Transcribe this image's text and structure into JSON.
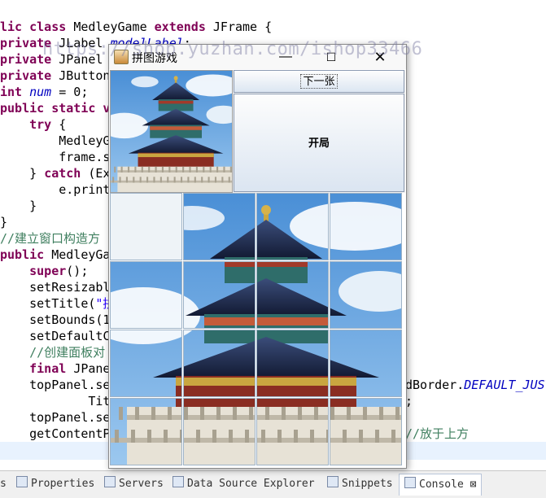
{
  "code_lines": [
    {
      "segments": [
        {
          "t": "lic class MedleyGame ",
          "c": "kw2"
        },
        {
          "t": "extends ",
          "c": "kw"
        },
        {
          "t": "JFrame {",
          "c": ""
        }
      ]
    },
    {
      "segments": [
        {
          "t": "private ",
          "c": "kw"
        },
        {
          "t": "JLabel ",
          "c": ""
        },
        {
          "t": "modelLabel",
          "c": "fld"
        },
        {
          "t": ";",
          "c": ""
        }
      ]
    },
    {
      "segments": [
        {
          "t": "private ",
          "c": "kw"
        },
        {
          "t": "JPanel",
          "c": ""
        }
      ]
    },
    {
      "segments": [
        {
          "t": "private ",
          "c": "kw"
        },
        {
          "t": "JButton",
          "c": ""
        }
      ]
    },
    {
      "segments": [
        {
          "t": "int ",
          "c": "kw"
        },
        {
          "t": "num",
          "c": "fld"
        },
        {
          "t": " = 0;",
          "c": ""
        }
      ]
    },
    {
      "segments": [
        {
          "t": "public static v",
          "c": "kw"
        }
      ]
    },
    {
      "segments": [
        {
          "t": "    try ",
          "c": "kw"
        },
        {
          "t": "{",
          "c": ""
        }
      ]
    },
    {
      "segments": [
        {
          "t": "        MedleyG",
          "c": ""
        }
      ]
    },
    {
      "segments": [
        {
          "t": "        frame.s",
          "c": ""
        }
      ]
    },
    {
      "segments": [
        {
          "t": "    } ",
          "c": ""
        },
        {
          "t": "catch ",
          "c": "kw"
        },
        {
          "t": "(Ex",
          "c": ""
        }
      ]
    },
    {
      "segments": [
        {
          "t": "        e.print",
          "c": ""
        }
      ]
    },
    {
      "segments": [
        {
          "t": "    }",
          "c": ""
        }
      ]
    },
    {
      "segments": [
        {
          "t": "}",
          "c": ""
        }
      ]
    },
    {
      "segments": [
        {
          "t": "//建立窗口构造方",
          "c": "cm"
        }
      ]
    },
    {
      "segments": [
        {
          "t": "public ",
          "c": "kw"
        },
        {
          "t": "MedleyGa",
          "c": ""
        }
      ]
    },
    {
      "segments": [
        {
          "t": "    super",
          "c": "kw"
        },
        {
          "t": "();",
          "c": ""
        }
      ]
    },
    {
      "segments": [
        {
          "t": "    setResizabl",
          "c": ""
        }
      ]
    },
    {
      "segments": [
        {
          "t": "    setTitle(",
          "c": ""
        },
        {
          "t": "\"拼",
          "c": "st"
        }
      ]
    },
    {
      "segments": [
        {
          "t": "    setBounds(1",
          "c": ""
        }
      ]
    },
    {
      "segments": [
        {
          "t": "    setDefaultC",
          "c": ""
        }
      ]
    },
    {
      "segments": [
        {
          "t": "    //创建面板对",
          "c": "cm"
        }
      ]
    },
    {
      "segments": [
        {
          "t": "    final ",
          "c": "kw"
        },
        {
          "t": "JPane",
          "c": ""
        }
      ]
    },
    {
      "segments": [
        {
          "t": "    topPanel.se",
          "c": ""
        }
      ]
    },
    {
      "segments": [
        {
          "t": "            Tit",
          "c": ""
        }
      ]
    },
    {
      "segments": [
        {
          "t": "    topPanel.se",
          "c": ""
        }
      ]
    },
    {
      "segments": [
        {
          "t": "    getContentP",
          "c": ""
        }
      ]
    }
  ],
  "code_right_fragments": [
    {
      "row": 22,
      "segments": [
        {
          "t": "dBorder.",
          "c": ""
        },
        {
          "t": "DEFAULT_JUST",
          "c": "fld"
        }
      ]
    },
    {
      "row": 23,
      "segments": [
        {
          "t": ";",
          "c": ""
        }
      ]
    },
    {
      "row": 25,
      "segments": [
        {
          "t": "//放于上方",
          "c": "cm"
        }
      ]
    }
  ],
  "watermark": "https://shop.yuzhan.com/ishop33466",
  "window": {
    "title": "拼图游戏",
    "minimize": "—",
    "maximize": "☐",
    "close": "✕",
    "next_button": "下一张",
    "start_button": "开局"
  },
  "puzzle": {
    "rows": 4,
    "cols": 4,
    "blank_index": 0
  },
  "bottom_tabs": [
    {
      "label": "s",
      "icon": "none-icon"
    },
    {
      "label": "Properties",
      "icon": "properties-icon"
    },
    {
      "label": "Servers",
      "icon": "servers-icon"
    },
    {
      "label": "Data Source Explorer",
      "icon": "data-source-icon"
    },
    {
      "label": "Snippets",
      "icon": "snippets-icon"
    },
    {
      "label": "Console",
      "icon": "console-icon",
      "active": true,
      "close": "⊠"
    }
  ]
}
